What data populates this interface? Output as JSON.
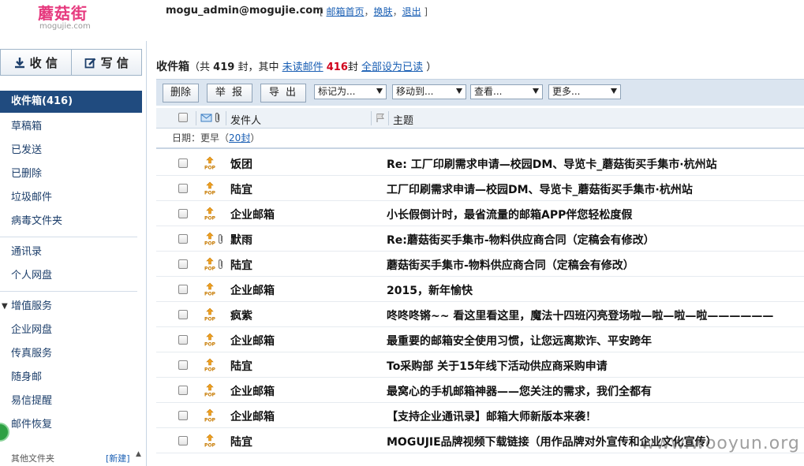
{
  "header": {
    "logo_text": "蘑菇街",
    "logo_sub": "mogujie.com",
    "account": "mogu_admin@mogujie.com",
    "links": {
      "open": "[",
      "home": "邮箱首页",
      "comma1": "，",
      "skin": "换肤",
      "comma2": "，",
      "logout": "退出",
      "close": "]"
    }
  },
  "sidebar": {
    "compose": {
      "receive_label": "收 信",
      "write_label": "写 信"
    },
    "inbox_label": "收件箱(416)",
    "folders": [
      "草稿箱",
      "已发送",
      "已删除",
      "垃圾邮件",
      "病毒文件夹"
    ],
    "tools": [
      "通讯录",
      "个人网盘"
    ],
    "services_group": "增值服务",
    "services": [
      "企业网盘",
      "传真服务",
      "随身邮",
      "易信提醒",
      "邮件恢复"
    ],
    "bottom_left": "其他文件夹",
    "bottom_right": "[新建]"
  },
  "main": {
    "title": {
      "folder": "收件箱",
      "p1": "（共",
      "total": "419",
      "p2": "封，其中",
      "unread_link": "未读邮件",
      "unread_count": "416",
      "p3": "封",
      "mark_all": "全部设为已读",
      "p4": "）"
    },
    "toolbar": {
      "delete": "删除",
      "report": "举 报",
      "export": "导 出",
      "mark_as": "标记为...",
      "move_to": "移动到...",
      "view": "查看...",
      "more": "更多..."
    },
    "columns": {
      "sender": "发件人",
      "subject": "主题"
    },
    "date_group": {
      "label": "日期：",
      "period": "更早",
      "open": "（",
      "count": "20封",
      "close": "）"
    },
    "emails": [
      {
        "sender": "饭团",
        "subject": "Re: 工厂印刷需求申请—校园DM、导览卡_蘑菇街买手集市·杭州站",
        "attachment": false
      },
      {
        "sender": "陆宜",
        "subject": "工厂印刷需求申请—校园DM、导览卡_蘑菇街买手集市·杭州站",
        "attachment": false
      },
      {
        "sender": "企业邮箱",
        "subject": "小长假倒计时，最省流量的邮箱APP伴您轻松度假",
        "attachment": false
      },
      {
        "sender": "默雨",
        "subject": "Re:蘑菇街买手集市-物料供应商合同（定稿会有修改）",
        "attachment": true
      },
      {
        "sender": "陆宜",
        "subject": "蘑菇街买手集市-物料供应商合同（定稿会有修改）",
        "attachment": true
      },
      {
        "sender": "企业邮箱",
        "subject": "2015，新年愉快",
        "attachment": false
      },
      {
        "sender": "疯紫",
        "subject": "咚咚咚锵~~ 看这里看这里，魔法十四班闪亮登场啦—啦—啦—啦——————",
        "attachment": false
      },
      {
        "sender": "企业邮箱",
        "subject": "最重要的邮箱安全使用习惯，让您远离欺诈、平安跨年",
        "attachment": false
      },
      {
        "sender": "陆宜",
        "subject": "To采购部 关于15年线下活动供应商采购申请",
        "attachment": false
      },
      {
        "sender": "企业邮箱",
        "subject": "最窝心的手机邮箱神器——您关注的需求，我们全都有",
        "attachment": false
      },
      {
        "sender": "企业邮箱",
        "subject": "【支持企业通讯录】邮箱大师新版本来袭！",
        "attachment": false
      },
      {
        "sender": "陆宜",
        "subject": "MOGUJIE品牌视频下载链接（用作品牌对外宣传和企业文化宣传）",
        "attachment": false
      }
    ]
  },
  "watermark": "www.wooyun.org"
}
